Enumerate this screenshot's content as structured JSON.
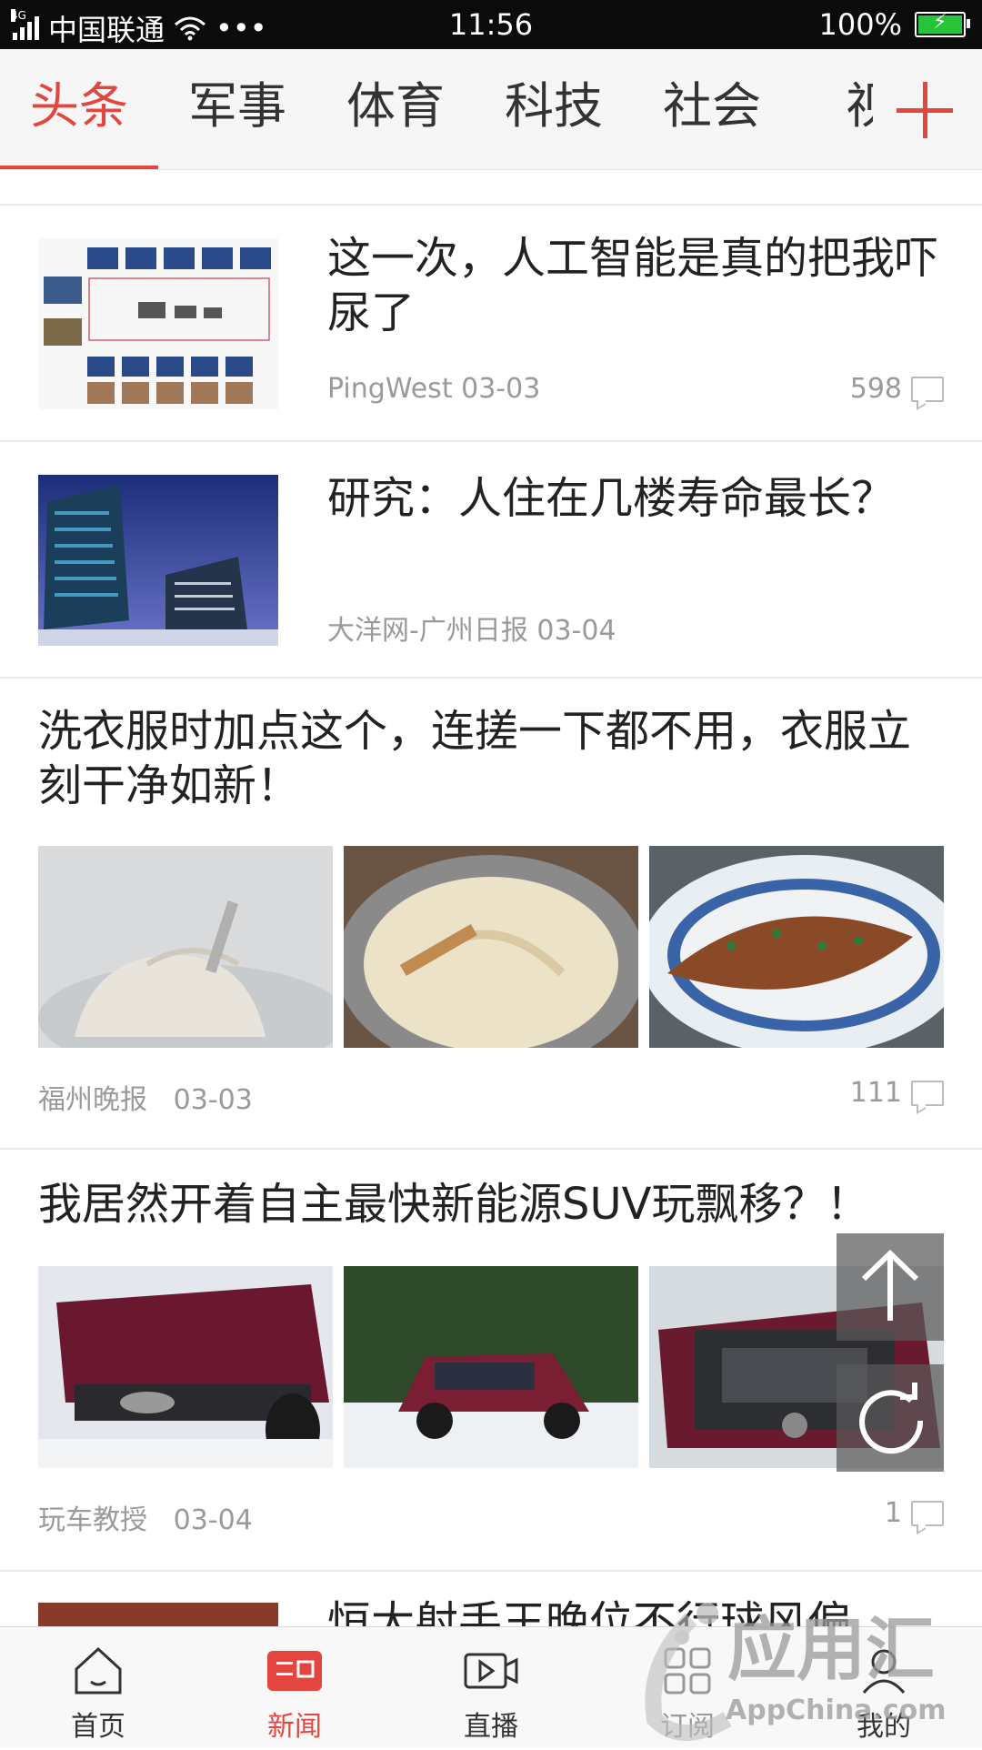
{
  "status_bar": {
    "network_type": "4G",
    "carrier": "中国联通",
    "dots": "•••",
    "time": "11:56",
    "battery": "100%"
  },
  "tabs": {
    "items": [
      "头条",
      "军事",
      "体育",
      "科技",
      "社会",
      "视"
    ],
    "active_index": 0
  },
  "articles": [
    {
      "title": "这一次，人工智能是真的把我吓尿了",
      "source": "PingWest",
      "date": "03-03",
      "comments": "598"
    },
    {
      "title": "研究：人住在几楼寿命最长？",
      "source": "大洋网-广州日报",
      "date": "03-04"
    },
    {
      "title": "洗衣服时加点这个，连搓一下都不用，衣服立刻干净如新！",
      "source": "福州晚报",
      "date": "03-03",
      "comments": "111"
    },
    {
      "title": "我居然开着自主最快新能源SUV玩飘移？！",
      "source": "玩车教授",
      "date": "03-04",
      "comments": "1"
    },
    {
      "title": "恒大射手王晚位不行球风偏"
    }
  ],
  "bottom_nav": {
    "items": [
      "首页",
      "新闻",
      "直播",
      "订阅",
      "我的"
    ],
    "active_index": 1
  },
  "watermark": {
    "cn": "应用汇",
    "en": "AppChina.com"
  },
  "colors": {
    "accent": "#e3463f",
    "battery": "#27c43a",
    "meta_text": "#9a9a9a"
  }
}
